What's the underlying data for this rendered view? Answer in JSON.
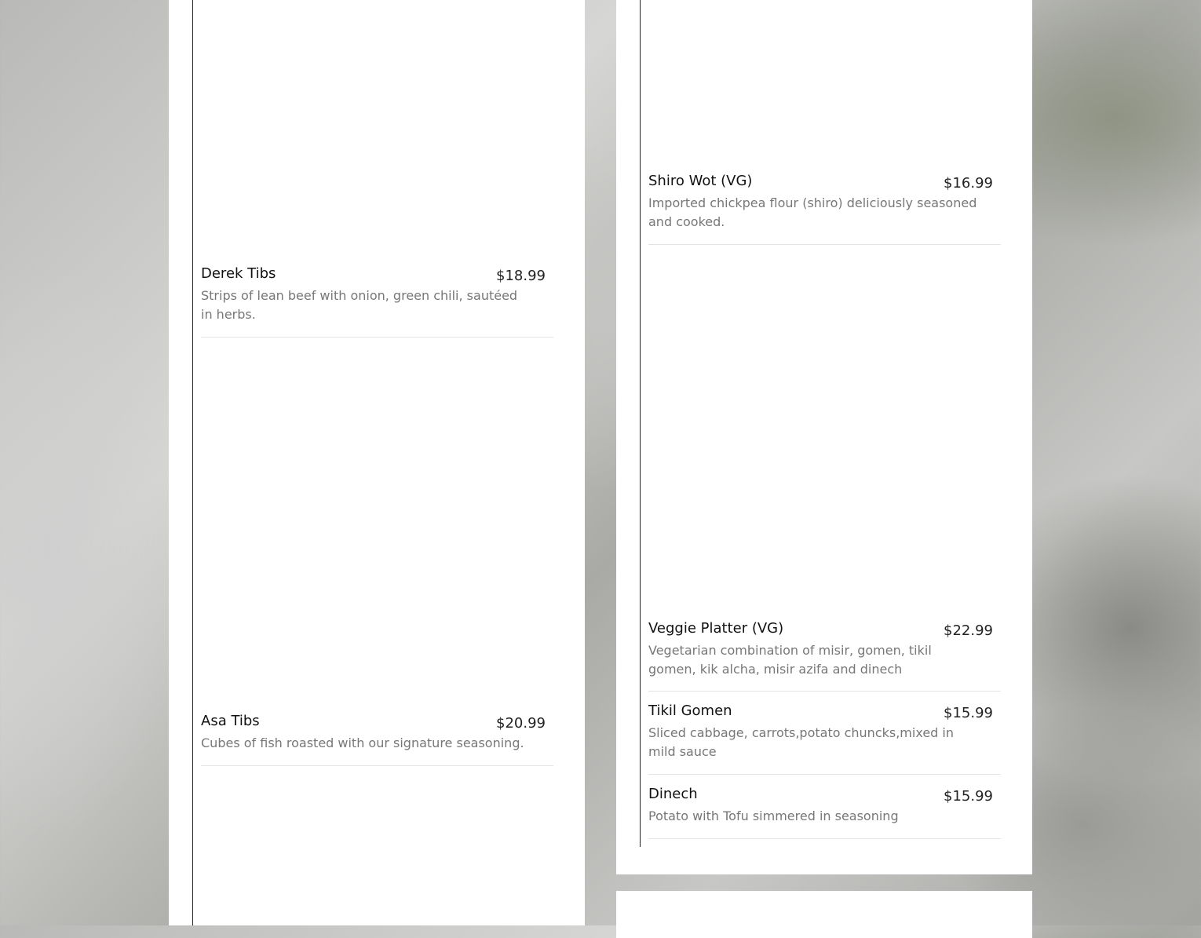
{
  "left_column": {
    "items": [
      {
        "name": "Derek Tibs",
        "price": "$18.99",
        "description": "Strips of lean beef with onion, green chili, sautéed in herbs."
      },
      {
        "name": "Asa Tibs",
        "price": "$20.99",
        "description": "Cubes of fish roasted with our signature seasoning."
      }
    ]
  },
  "right_column": {
    "items": [
      {
        "name": "Shiro Wot (VG)",
        "price": "$16.99",
        "description": "Imported chickpea flour (shiro) deliciously seasoned and cooked."
      },
      {
        "name": "Veggie Platter (VG)",
        "price": "$22.99",
        "description": "Vegetarian combination of misir, gomen, tikil gomen, kik alcha, misir azifa and dinech"
      },
      {
        "name": "Tikil Gomen",
        "price": "$15.99",
        "description": "Sliced cabbage, carrots,potato chuncks,mixed in mild sauce"
      },
      {
        "name": "Dinech",
        "price": "$15.99",
        "description": "Potato with Tofu simmered in seasoning"
      }
    ]
  }
}
